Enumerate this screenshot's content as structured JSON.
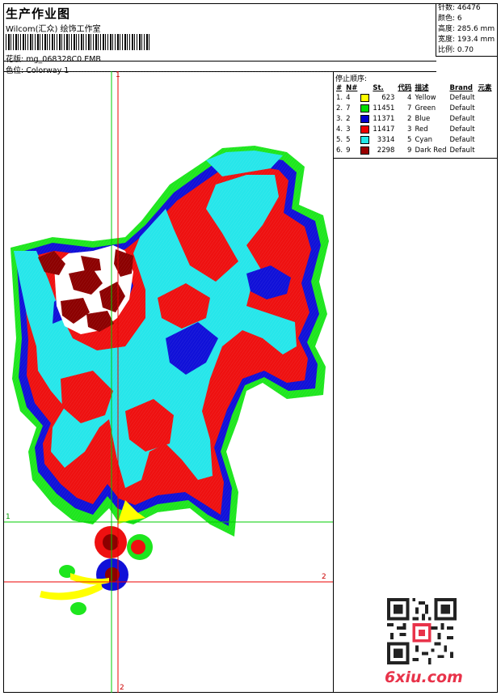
{
  "header": {
    "title": "生产作业图",
    "company": "Wilcom(汇众) 绘饰工作室",
    "design_label": "花版:",
    "design_name": "mg_068328C0.EMB",
    "colorway_label": "色位:",
    "colorway_name": "Colorway 1"
  },
  "info": [
    {
      "label": "针数:",
      "value": "46476"
    },
    {
      "label": "颜色:",
      "value": "6"
    },
    {
      "label": "高度:",
      "value": "285.6 mm"
    },
    {
      "label": "宽度:",
      "value": "193.4 mm"
    },
    {
      "label": "比例:",
      "value": "0.70"
    }
  ],
  "stop_panel": {
    "title": "停止顺序:",
    "headers": [
      "#",
      "N#",
      "St.",
      "代码",
      "描述",
      "Brand",
      "元素"
    ],
    "rows": [
      {
        "idx": "1.",
        "n": "4",
        "color": "#ffff00",
        "st": "623",
        "code": "4",
        "desc": "Yellow",
        "brand": "Default"
      },
      {
        "idx": "2.",
        "n": "7",
        "color": "#00dd00",
        "st": "11451",
        "code": "7",
        "desc": "Green",
        "brand": "Default"
      },
      {
        "idx": "3.",
        "n": "2",
        "color": "#0000cc",
        "st": "11371",
        "code": "2",
        "desc": "Blue",
        "brand": "Default"
      },
      {
        "idx": "4.",
        "n": "3",
        "color": "#ee0000",
        "st": "11417",
        "code": "3",
        "desc": "Red",
        "brand": "Default"
      },
      {
        "idx": "5.",
        "n": "5",
        "color": "#22e8e8",
        "st": "3314",
        "code": "5",
        "desc": "Cyan",
        "brand": "Default"
      },
      {
        "idx": "6.",
        "n": "9",
        "color": "#990000",
        "st": "2298",
        "code": "9",
        "desc": "Dark Red",
        "brand": "Default"
      }
    ]
  },
  "axes": {
    "top_label": "1",
    "bottom_label": "2",
    "left_label": "1",
    "right_label": "2"
  },
  "watermark": "6xiu.com"
}
